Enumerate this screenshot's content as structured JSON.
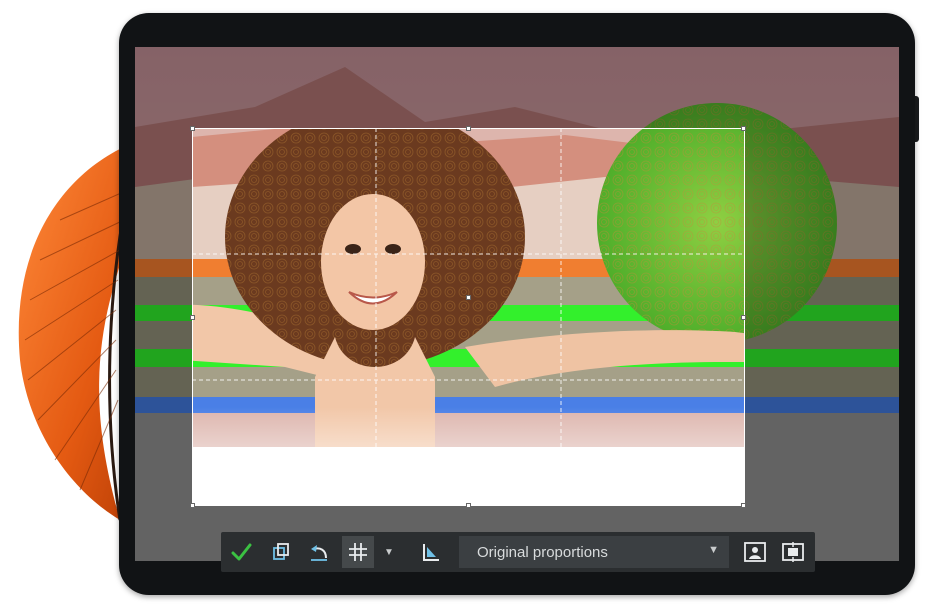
{
  "toolbar": {
    "confirm_icon": "checkmark-icon",
    "icons": [
      "checkmark-icon",
      "crop-rotate-icon",
      "undo-icon",
      "grid-icon",
      "dropdown-arrow-icon",
      "straighten-icon",
      "portrait-icon",
      "fit-icon"
    ],
    "proportions_value": "Original proportions",
    "accent_color": "#3bc142"
  },
  "colors": {
    "feather": "#f36a1c",
    "stripe_orange": "#e8772d",
    "stripe_green": "#2ee32a",
    "stripe_blue": "#3f73d4",
    "sun": "#6cc43c"
  }
}
